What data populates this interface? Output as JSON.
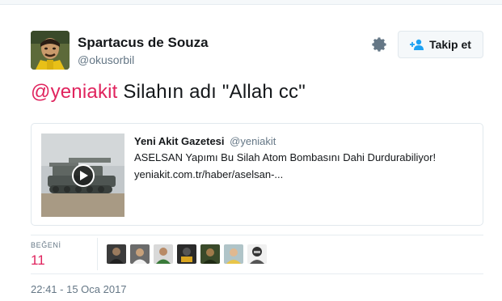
{
  "author": {
    "name": "Spartacus de Souza",
    "handle": "@okusorbil",
    "avatar": "avatar"
  },
  "actions": {
    "settings_icon": "gear-icon",
    "follow_label": "Takip et",
    "follow_icon": "add-user-icon"
  },
  "tweet": {
    "mention": "@yeniakit",
    "text": " Silahın adı \"Allah cc\""
  },
  "card": {
    "source_name": "Yeni Akit Gazetesi",
    "source_handle": "@yeniakit",
    "title": "ASELSAN Yapımı Bu Silah Atom Bombasını Dahi Durdurabiliyor!",
    "url": "yeniakit.com.tr/haber/aselsan-...",
    "media_icon": "play-icon"
  },
  "stats": {
    "likes_label": "BEĞENİ",
    "likes_count": "11",
    "liker_avatars": 7
  },
  "timestamp": "22:41 - 15 Oca 2017",
  "colors": {
    "accent": "#e0245e",
    "muted": "#657786",
    "text": "#14171a",
    "border": "#e1e8ed"
  }
}
